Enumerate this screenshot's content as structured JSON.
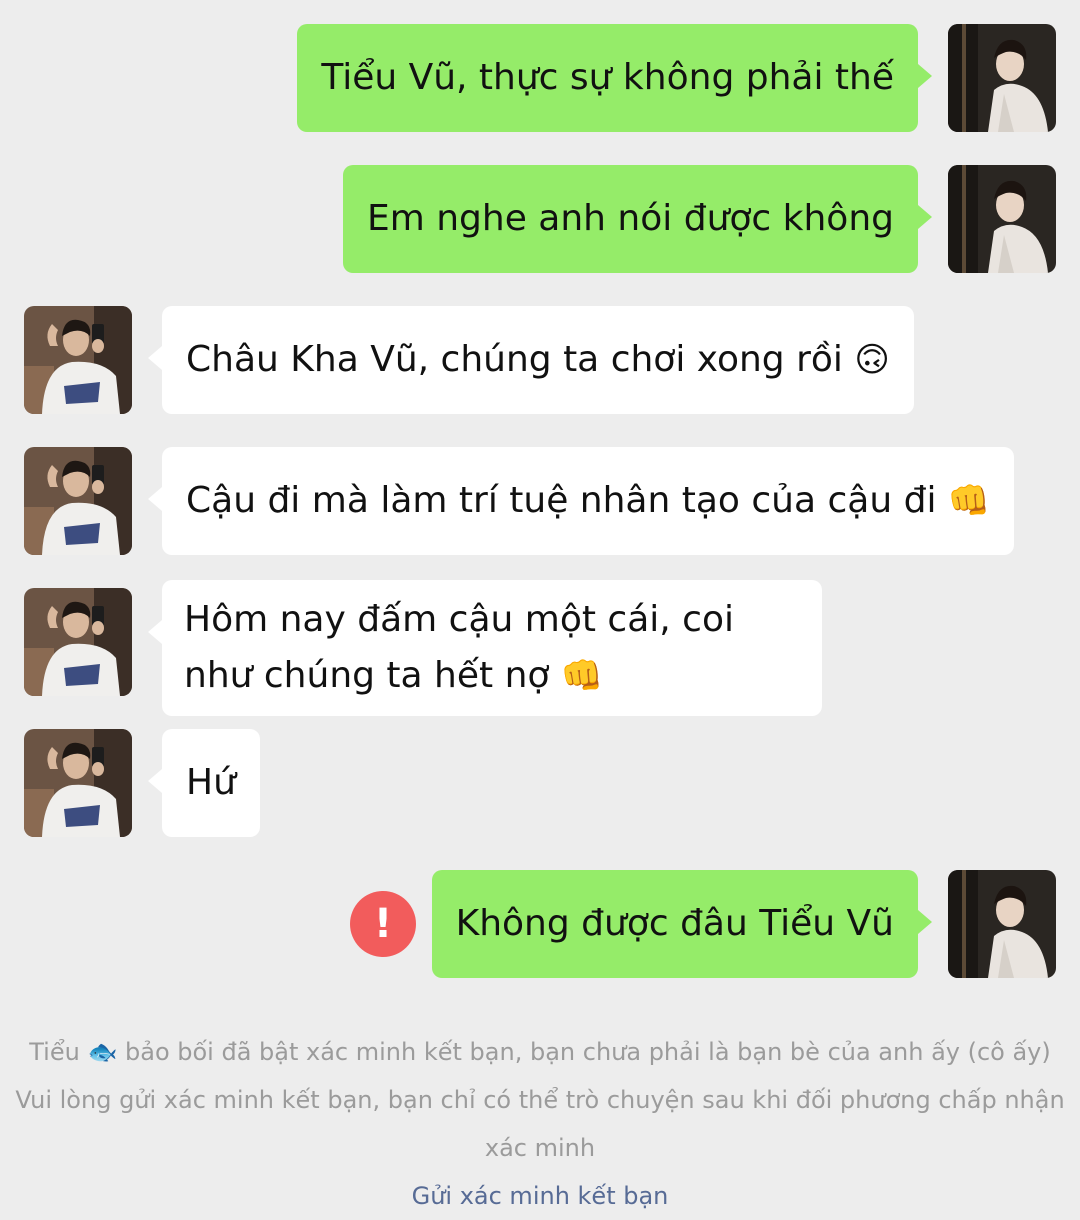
{
  "messages": [
    {
      "side": "me",
      "text": "Tiểu Vũ, thực sự không phải thế",
      "emoji": ""
    },
    {
      "side": "me",
      "text": "Em nghe anh nói được không",
      "emoji": ""
    },
    {
      "side": "them",
      "text": "Châu Kha Vũ, chúng ta chơi xong rồi",
      "emoji": "🙃"
    },
    {
      "side": "them",
      "text": "Cậu đi mà làm trí tuệ nhân tạo của cậu đi",
      "emoji": "👊"
    },
    {
      "side": "them",
      "text": "Hôm nay đấm cậu một cái, coi như chúng ta hết nợ",
      "emoji": "👊"
    },
    {
      "side": "them",
      "text": "Hứ",
      "emoji": ""
    },
    {
      "side": "me",
      "text": "Không được đâu Tiểu Vũ",
      "emoji": "",
      "failed_icon": "!"
    }
  ],
  "system_notice": {
    "line1_prefix": "Tiểu",
    "line1_emoji": "🐟",
    "line1_suffix": "bảo bối đã bật xác minh kết bạn, bạn chưa phải là bạn bè của anh ấy (cô ấy)",
    "line2": "Vui lòng gửi xác minh kết bạn, bạn chỉ có thể trò chuyện sau khi đối phương chấp nhận xác minh",
    "link": "Gửi xác minh kết bạn"
  },
  "colors": {
    "background": "#ededed",
    "my_bubble": "#95ec69",
    "their_bubble": "#ffffff",
    "error_icon": "#f25c5c",
    "link": "#576b95",
    "notice_text": "#9b9b9b"
  },
  "icons": {
    "failed_send": "exclamation-icon",
    "my_avatar": "avatar-photo-icon",
    "their_avatar": "avatar-photo-icon"
  }
}
